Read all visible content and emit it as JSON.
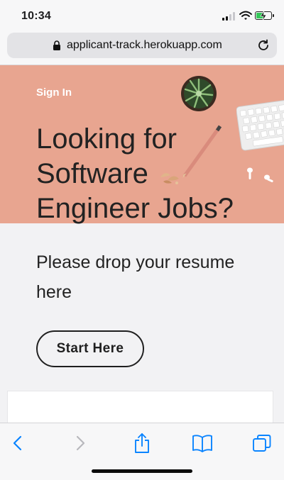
{
  "status_bar": {
    "time": "10:34",
    "signal_bars_active": 2,
    "signal_bars_total": 4,
    "battery_level": 0.5,
    "battery_charging": true,
    "icons": [
      "signal-icon",
      "wifi-icon",
      "battery-icon"
    ]
  },
  "browser": {
    "url": "applicant-track.herokuapp.com",
    "icons": [
      "lock-icon",
      "reload-icon"
    ]
  },
  "hero": {
    "sign_in": "Sign In",
    "headline_lines": [
      "Looking for",
      "Software",
      "Engineer Jobs?"
    ],
    "background_color": "#e8a590"
  },
  "main": {
    "subhead_lines": [
      "Please drop your resume",
      "here"
    ],
    "start_button": "Start Here"
  },
  "toolbar": {
    "items": [
      "back-icon",
      "forward-icon",
      "share-icon",
      "bookmarks-icon",
      "tabs-icon"
    ],
    "accent_color": "#0a84ff",
    "disabled_color": "#b8b8bd"
  }
}
